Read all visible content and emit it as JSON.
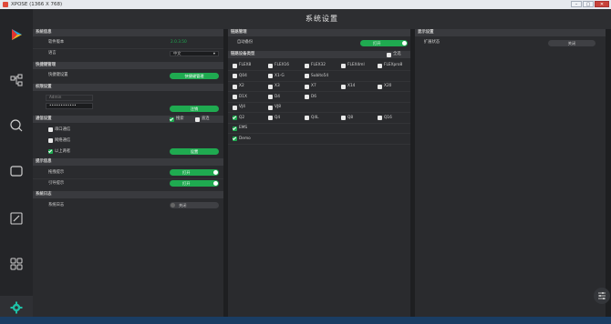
{
  "titlebar": {
    "title": "XPOSE (1366 X 768)"
  },
  "header": {
    "title": "系统设置"
  },
  "sidebar": {
    "items": [
      {
        "icon": "play-logo-icon"
      },
      {
        "icon": "network-icon"
      },
      {
        "icon": "search-icon"
      },
      {
        "icon": "screen-icon"
      },
      {
        "icon": "edit-icon"
      },
      {
        "icon": "grid-icon"
      },
      {
        "icon": "settings-gear-icon"
      }
    ]
  },
  "col1": {
    "sys_info": {
      "title": "系统信息",
      "version_label": "软件版本",
      "version_value": "2.0.3.50",
      "lang_label": "语言",
      "lang_value": "中文"
    },
    "shortcut": {
      "title": "快捷键管理",
      "label": "快捷键设置",
      "button": "快捷键管理"
    },
    "auth": {
      "title": "权限设置",
      "user": "Admin",
      "password": "••••••••••••",
      "button": "注销"
    },
    "comm": {
      "title": "通信设置",
      "opt_search": "搜索",
      "opt_direct": "直连",
      "serial": "串口通信",
      "network": "网络通信",
      "above": "以上两者",
      "button": "设置"
    },
    "prompt": {
      "title": "提示信息",
      "drag_label": "拖拽提示",
      "drag_value": "打开",
      "guide_label": "引导提示",
      "guide_value": "打开"
    },
    "log": {
      "title": "系统日志",
      "label": "系统日志",
      "value": "关闭"
    }
  },
  "col2": {
    "backup": {
      "title": "链路管理",
      "auto_label": "自动备份",
      "auto_value": "打开"
    },
    "device": {
      "title": "链路设备类型",
      "select_all": "全选",
      "rows": [
        [
          {
            "label": "FLEX8",
            "on": false
          },
          {
            "label": "FLEX16",
            "on": false
          },
          {
            "label": "FLEX32",
            "on": false
          },
          {
            "label": "FLEX4ml",
            "on": false
          },
          {
            "label": "FLEXpro8",
            "on": false
          }
        ],
        [
          {
            "label": "Q04",
            "on": false
          },
          {
            "label": "X1-G",
            "on": false
          },
          {
            "label": "Subito54",
            "on": false
          }
        ],
        [
          {
            "label": "X2",
            "on": false
          },
          {
            "label": "X3",
            "on": false
          },
          {
            "label": "X7",
            "on": false
          },
          {
            "label": "X14",
            "on": false
          },
          {
            "label": "X20",
            "on": false
          }
        ],
        [
          {
            "label": "D1X",
            "on": false
          },
          {
            "label": "D4",
            "on": false
          },
          {
            "label": "D6",
            "on": false
          }
        ],
        [
          {
            "label": "VJ4",
            "on": false
          },
          {
            "label": "VJ8",
            "on": false
          }
        ],
        [
          {
            "label": "Q2",
            "on": true
          },
          {
            "label": "Q4",
            "on": false
          },
          {
            "label": "Q4L",
            "on": false
          },
          {
            "label": "Q8",
            "on": false
          },
          {
            "label": "Q16",
            "on": false
          }
        ],
        [
          {
            "label": "EMS",
            "on": true
          }
        ],
        [
          {
            "label": "Demo",
            "on": true
          }
        ]
      ]
    }
  },
  "col3": {
    "display": {
      "title": "显示设置",
      "ext_label": "扩展状态",
      "ext_value": "关闭"
    }
  },
  "colors": {
    "accent": "#1faa50",
    "panel": "#2a2b2e",
    "section": "#393a3e",
    "bg": "#1e1f21"
  }
}
